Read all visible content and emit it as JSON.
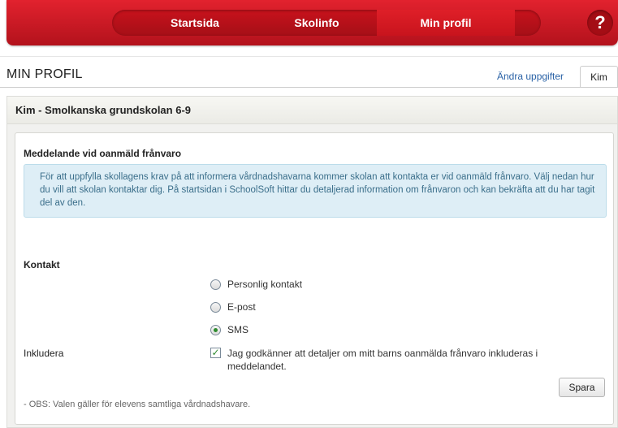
{
  "nav": {
    "items": [
      {
        "label": "Startsida"
      },
      {
        "label": "Skolinfo"
      },
      {
        "label": "Min profil",
        "active": true
      }
    ],
    "help_label": "?"
  },
  "header": {
    "title": "MIN PROFIL",
    "edit_link": "Ändra uppgifter",
    "user_tab": "Kim"
  },
  "panel": {
    "heading": "Kim - Smolkanska grundskolan 6-9",
    "section_title": "Meddelande vid oanmäld frånvaro",
    "info_text": "För att uppfylla skollagens krav på att informera vårdnadshavarna kommer skolan att kontakta er vid oanmäld frånvaro. Välj nedan hur du vill att skolan kontaktar dig. På startsidan i SchoolSoft hittar du detaljerad information om frånvaron och kan bekräfta att du har tagit del av den.",
    "contact_label": "Kontakt",
    "contact_options": [
      {
        "label": "Personlig kontakt",
        "checked": false
      },
      {
        "label": "E-post",
        "checked": false
      },
      {
        "label": "SMS",
        "checked": true
      }
    ],
    "include_label": "Inkludera",
    "include_checkbox_label": "Jag godkänner att detaljer om mitt barns oanmälda frånvaro inkluderas i meddelandet.",
    "include_checked": true,
    "save_label": "Spara",
    "note": "- OBS: Valen gäller för elevens samtliga vårdnadshavare."
  },
  "colors": {
    "brand_red": "#c8141d",
    "info_bg": "#deeef6",
    "link": "#2a62a6"
  }
}
